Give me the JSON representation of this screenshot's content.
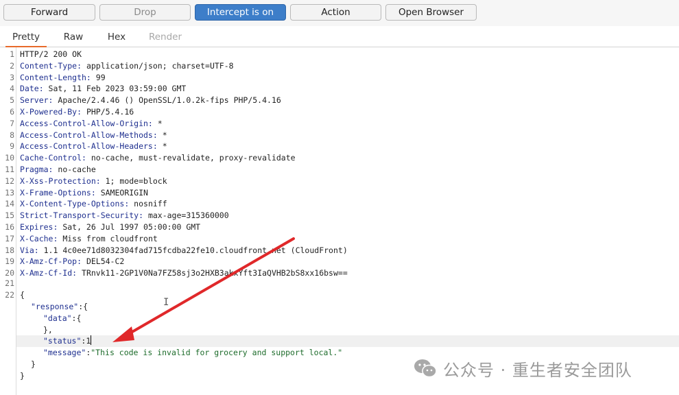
{
  "toolbar": {
    "buttons": [
      {
        "label": "Forward"
      },
      {
        "label": "Drop"
      },
      {
        "label": "Intercept is on"
      },
      {
        "label": "Action"
      },
      {
        "label": "Open Browser"
      }
    ]
  },
  "tabs": [
    {
      "label": "Pretty"
    },
    {
      "label": "Raw"
    },
    {
      "label": "Hex"
    },
    {
      "label": "Render"
    }
  ],
  "headers": [
    {
      "num": "1",
      "name": "",
      "value": "HTTP/2 200 OK"
    },
    {
      "num": "2",
      "name": "Content-Type:",
      "value": " application/json; charset=UTF-8"
    },
    {
      "num": "3",
      "name": "Content-Length:",
      "value": " 99"
    },
    {
      "num": "4",
      "name": "Date:",
      "value": " Sat, 11 Feb 2023 03:59:00 GMT"
    },
    {
      "num": "5",
      "name": "Server:",
      "value": " Apache/2.4.46 () OpenSSL/1.0.2k-fips PHP/5.4.16"
    },
    {
      "num": "6",
      "name": "X-Powered-By:",
      "value": " PHP/5.4.16"
    },
    {
      "num": "7",
      "name": "Access-Control-Allow-Origin:",
      "value": " *"
    },
    {
      "num": "8",
      "name": "Access-Control-Allow-Methods:",
      "value": " *"
    },
    {
      "num": "9",
      "name": "Access-Control-Allow-Headers:",
      "value": " *"
    },
    {
      "num": "10",
      "name": "Cache-Control:",
      "value": " no-cache, must-revalidate, proxy-revalidate"
    },
    {
      "num": "11",
      "name": "Pragma:",
      "value": " no-cache"
    },
    {
      "num": "12",
      "name": "X-Xss-Protection:",
      "value": " 1; mode=block"
    },
    {
      "num": "13",
      "name": "X-Frame-Options:",
      "value": " SAMEORIGIN"
    },
    {
      "num": "14",
      "name": "X-Content-Type-Options:",
      "value": " nosniff"
    },
    {
      "num": "15",
      "name": "Strict-Transport-Security:",
      "value": " max-age=315360000"
    },
    {
      "num": "16",
      "name": "Expires:",
      "value": " Sat, 26 Jul 1997 05:00:00 GMT"
    },
    {
      "num": "17",
      "name": "X-Cache:",
      "value": " Miss from cloudfront"
    },
    {
      "num": "18",
      "name": "Via:",
      "value": " 1.1 4c0ee71d8032304fad715fcdba22fe10.cloudfront.net (CloudFront)"
    },
    {
      "num": "19",
      "name": "X-Amz-Cf-Pop:",
      "value": " DEL54-C2"
    },
    {
      "num": "20",
      "name": "X-Amz-Cf-Id:",
      "value": " TRnvk11-2GP1V0Na7FZ58sj3o2HXB3akxYft3IaQVHB2bS8xx16bsw=="
    }
  ],
  "body": {
    "blank_num": "21",
    "start_num": "22",
    "open_brace": "{",
    "response_key": "\"response\"",
    "response_tail": ":{",
    "data_key": "\"data\"",
    "data_tail": ":{",
    "data_close": "},",
    "status_key": "\"status\"",
    "status_colon": ":",
    "status_value": "1",
    "message_key": "\"message\"",
    "message_colon": ":",
    "message_value": "\"This code is invalid for grocery and support local.\"",
    "inner_close": "}",
    "close_brace": "}"
  },
  "watermark": {
    "icon": "wechat-icon",
    "text": "公众号 · 重生者安全团队"
  },
  "colors": {
    "accent": "#3d7ec9",
    "tab_underline": "#e86a2a",
    "header_key": "#1e2f8f",
    "json_string": "#1c6b2a",
    "annotation_arrow": "#e0282a"
  }
}
